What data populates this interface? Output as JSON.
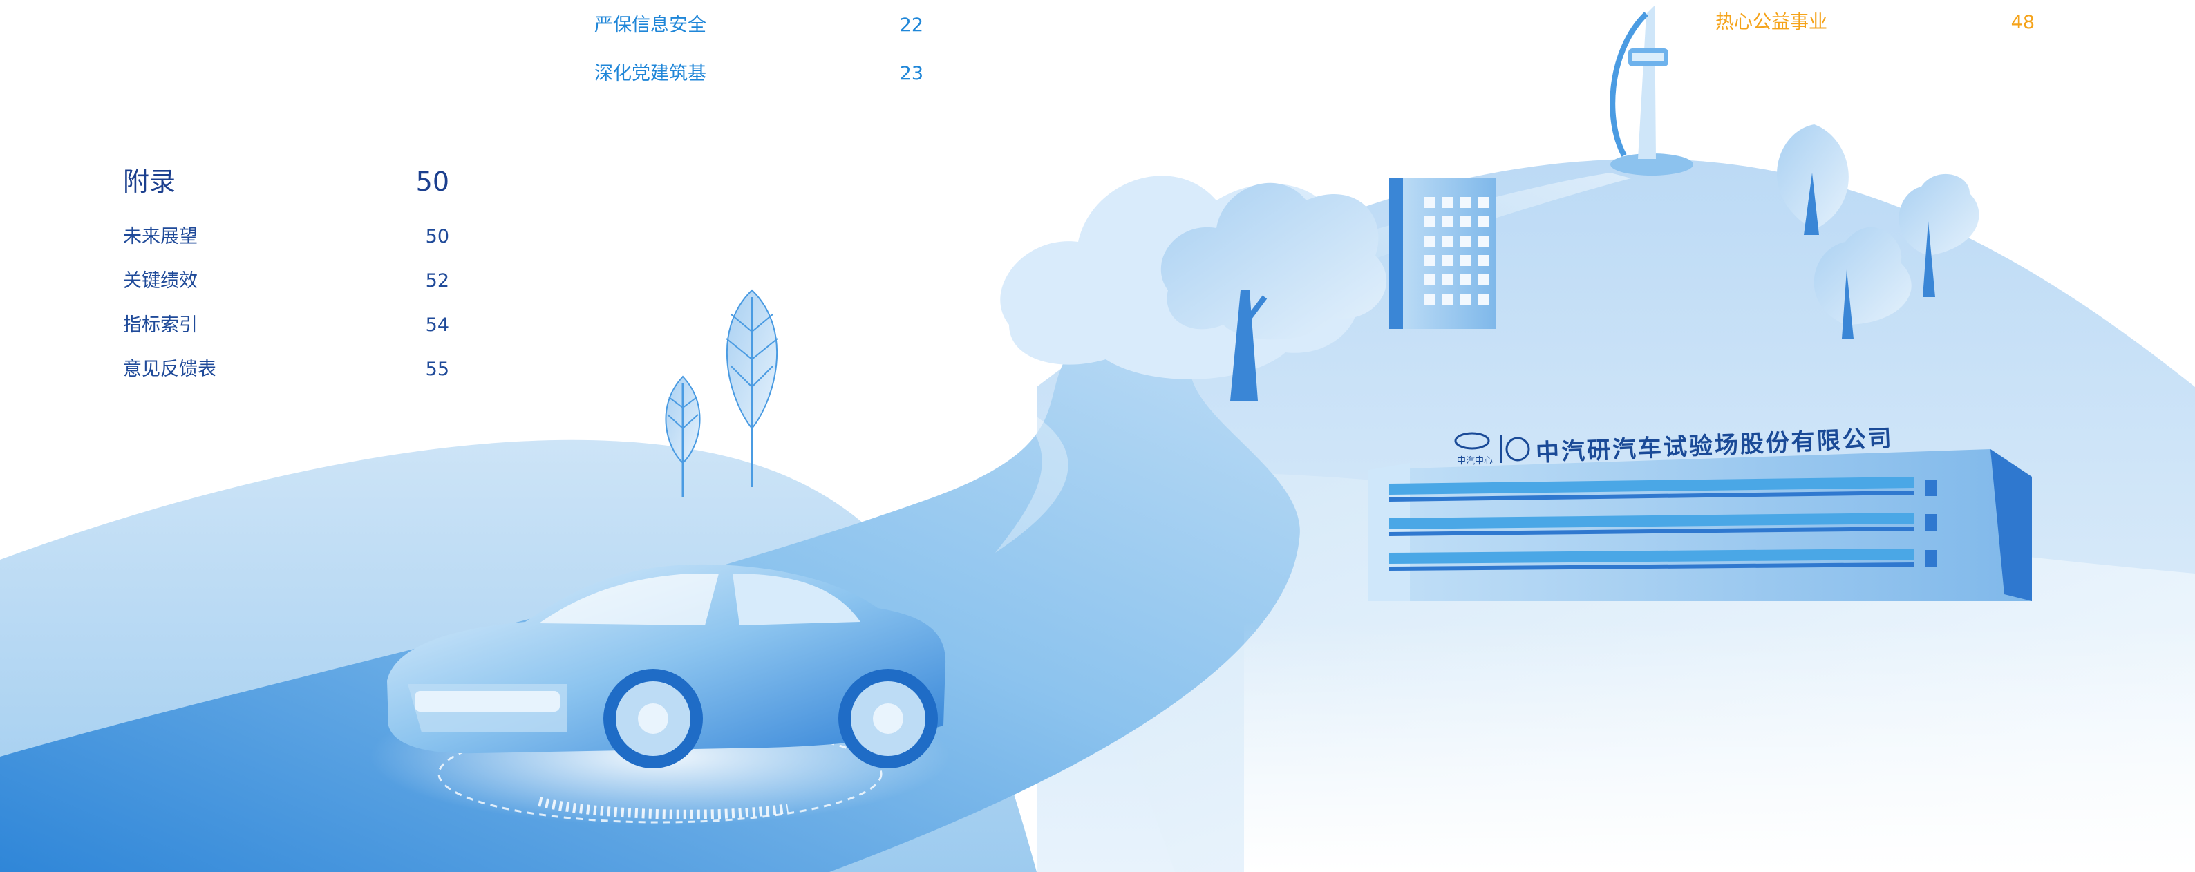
{
  "toc": {
    "middle_column": [
      {
        "label": "严保信息安全",
        "page": "22"
      },
      {
        "label": "深化党建筑基",
        "page": "23"
      }
    ],
    "right_column": [
      {
        "label": "热心公益事业",
        "page": "48"
      }
    ],
    "appendix": {
      "title": "附录",
      "page": "50",
      "items": [
        {
          "label": "未来展望",
          "page": "50"
        },
        {
          "label": "关键绩效",
          "page": "52"
        },
        {
          "label": "指标索引",
          "page": "54"
        },
        {
          "label": "意见反馈表",
          "page": "55"
        }
      ]
    }
  },
  "building_sign": {
    "company_name": "中汽研汽车试验场股份有限公司",
    "brand_small": "中汽中心"
  },
  "colors": {
    "appendix_text": "#1b3f8e",
    "middle_text": "#1f86d8",
    "highlight_orange": "#f5a31a",
    "sky_blue": "#cfe6f8",
    "deep_blue": "#2d77cf"
  }
}
